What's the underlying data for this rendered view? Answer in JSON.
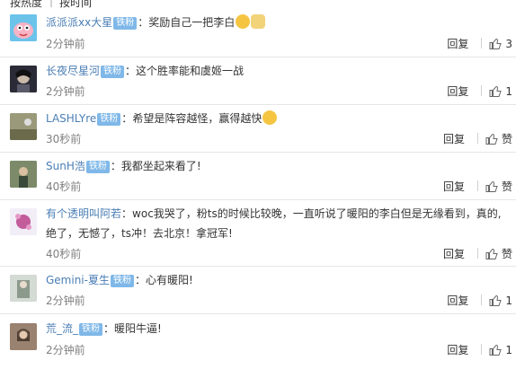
{
  "tabs": {
    "hot_label": "按热度",
    "time_label": "按时间"
  },
  "reply_label": "回复",
  "badge_label": "铁粉",
  "colors": {
    "username": "#eb7350",
    "username_blue": "#4a7eb5",
    "badge": "#7fb8e8",
    "time": "#808080"
  },
  "comments": [
    {
      "username": "派派派xx大星",
      "text": "奖励自己一把李白",
      "time": "2分钟前",
      "likes": "3",
      "emojis": [
        "smile-emoji",
        "cat-emoji"
      ]
    },
    {
      "username": "长夜尽星河",
      "text": "这个胜率能和虞姬一战",
      "time": "2分钟前",
      "likes": "1"
    },
    {
      "username": "LASHLYre",
      "text": "希望是阵容越怪，赢得越快",
      "time": "30秒前",
      "likes": "赞",
      "emojis": [
        "laugh-cry-emoji"
      ]
    },
    {
      "username": "SunH浩",
      "text": "我都坐起来看了!",
      "time": "40秒前",
      "likes": "赞"
    },
    {
      "username": "有个透明叫阿若",
      "text": "woc我哭了，粉ts的时候比较晚，一直听说了暖阳的李白但是无缘看到，真的,",
      "text2": "绝了，无憾了，ts冲！去北京！拿冠军!",
      "time": "40秒前",
      "likes": "赞"
    },
    {
      "username": "Gemini-夏生",
      "text": "心有暖阳!",
      "time": "2分钟前",
      "likes": "1"
    },
    {
      "username": "荒_流_",
      "text": "暖阳牛逼!",
      "time": "2分钟前",
      "likes": "1"
    }
  ]
}
